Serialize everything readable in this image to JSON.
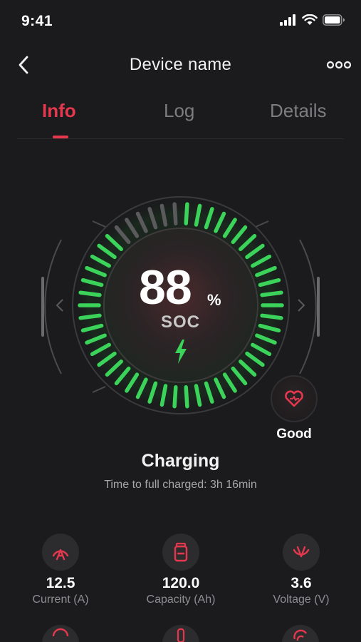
{
  "status_bar": {
    "time": "9:41"
  },
  "nav": {
    "title": "Device name",
    "back_icon": "chevron-left-icon",
    "more_icon": "more-dots-icon"
  },
  "tabs": [
    {
      "label": "Info",
      "active": true
    },
    {
      "label": "Log",
      "active": false
    },
    {
      "label": "Details",
      "active": false
    }
  ],
  "gauge": {
    "soc_value": "88",
    "soc_unit": "%",
    "soc_label": "SOC",
    "soc_fraction": 0.88,
    "active_color": "#3bd35a",
    "inactive_color": "#5a5a5c",
    "charging_icon": "lightning-bolt-icon"
  },
  "health": {
    "label": "Good",
    "icon": "heart-icon",
    "color": "#e5384e"
  },
  "charging": {
    "status": "Charging",
    "time_to_full": "Time to full charged: 3h 16min"
  },
  "metrics": [
    {
      "value": "12.5",
      "label": "Current (A)",
      "icon": "current-icon"
    },
    {
      "value": "120.0",
      "label": "Capacity (Ah)",
      "icon": "battery-icon"
    },
    {
      "value": "3.6",
      "label": "Voltage (V)",
      "icon": "voltage-icon"
    }
  ],
  "colors": {
    "accent": "#e5384e",
    "background": "#1b1b1d",
    "green": "#3bd35a"
  }
}
